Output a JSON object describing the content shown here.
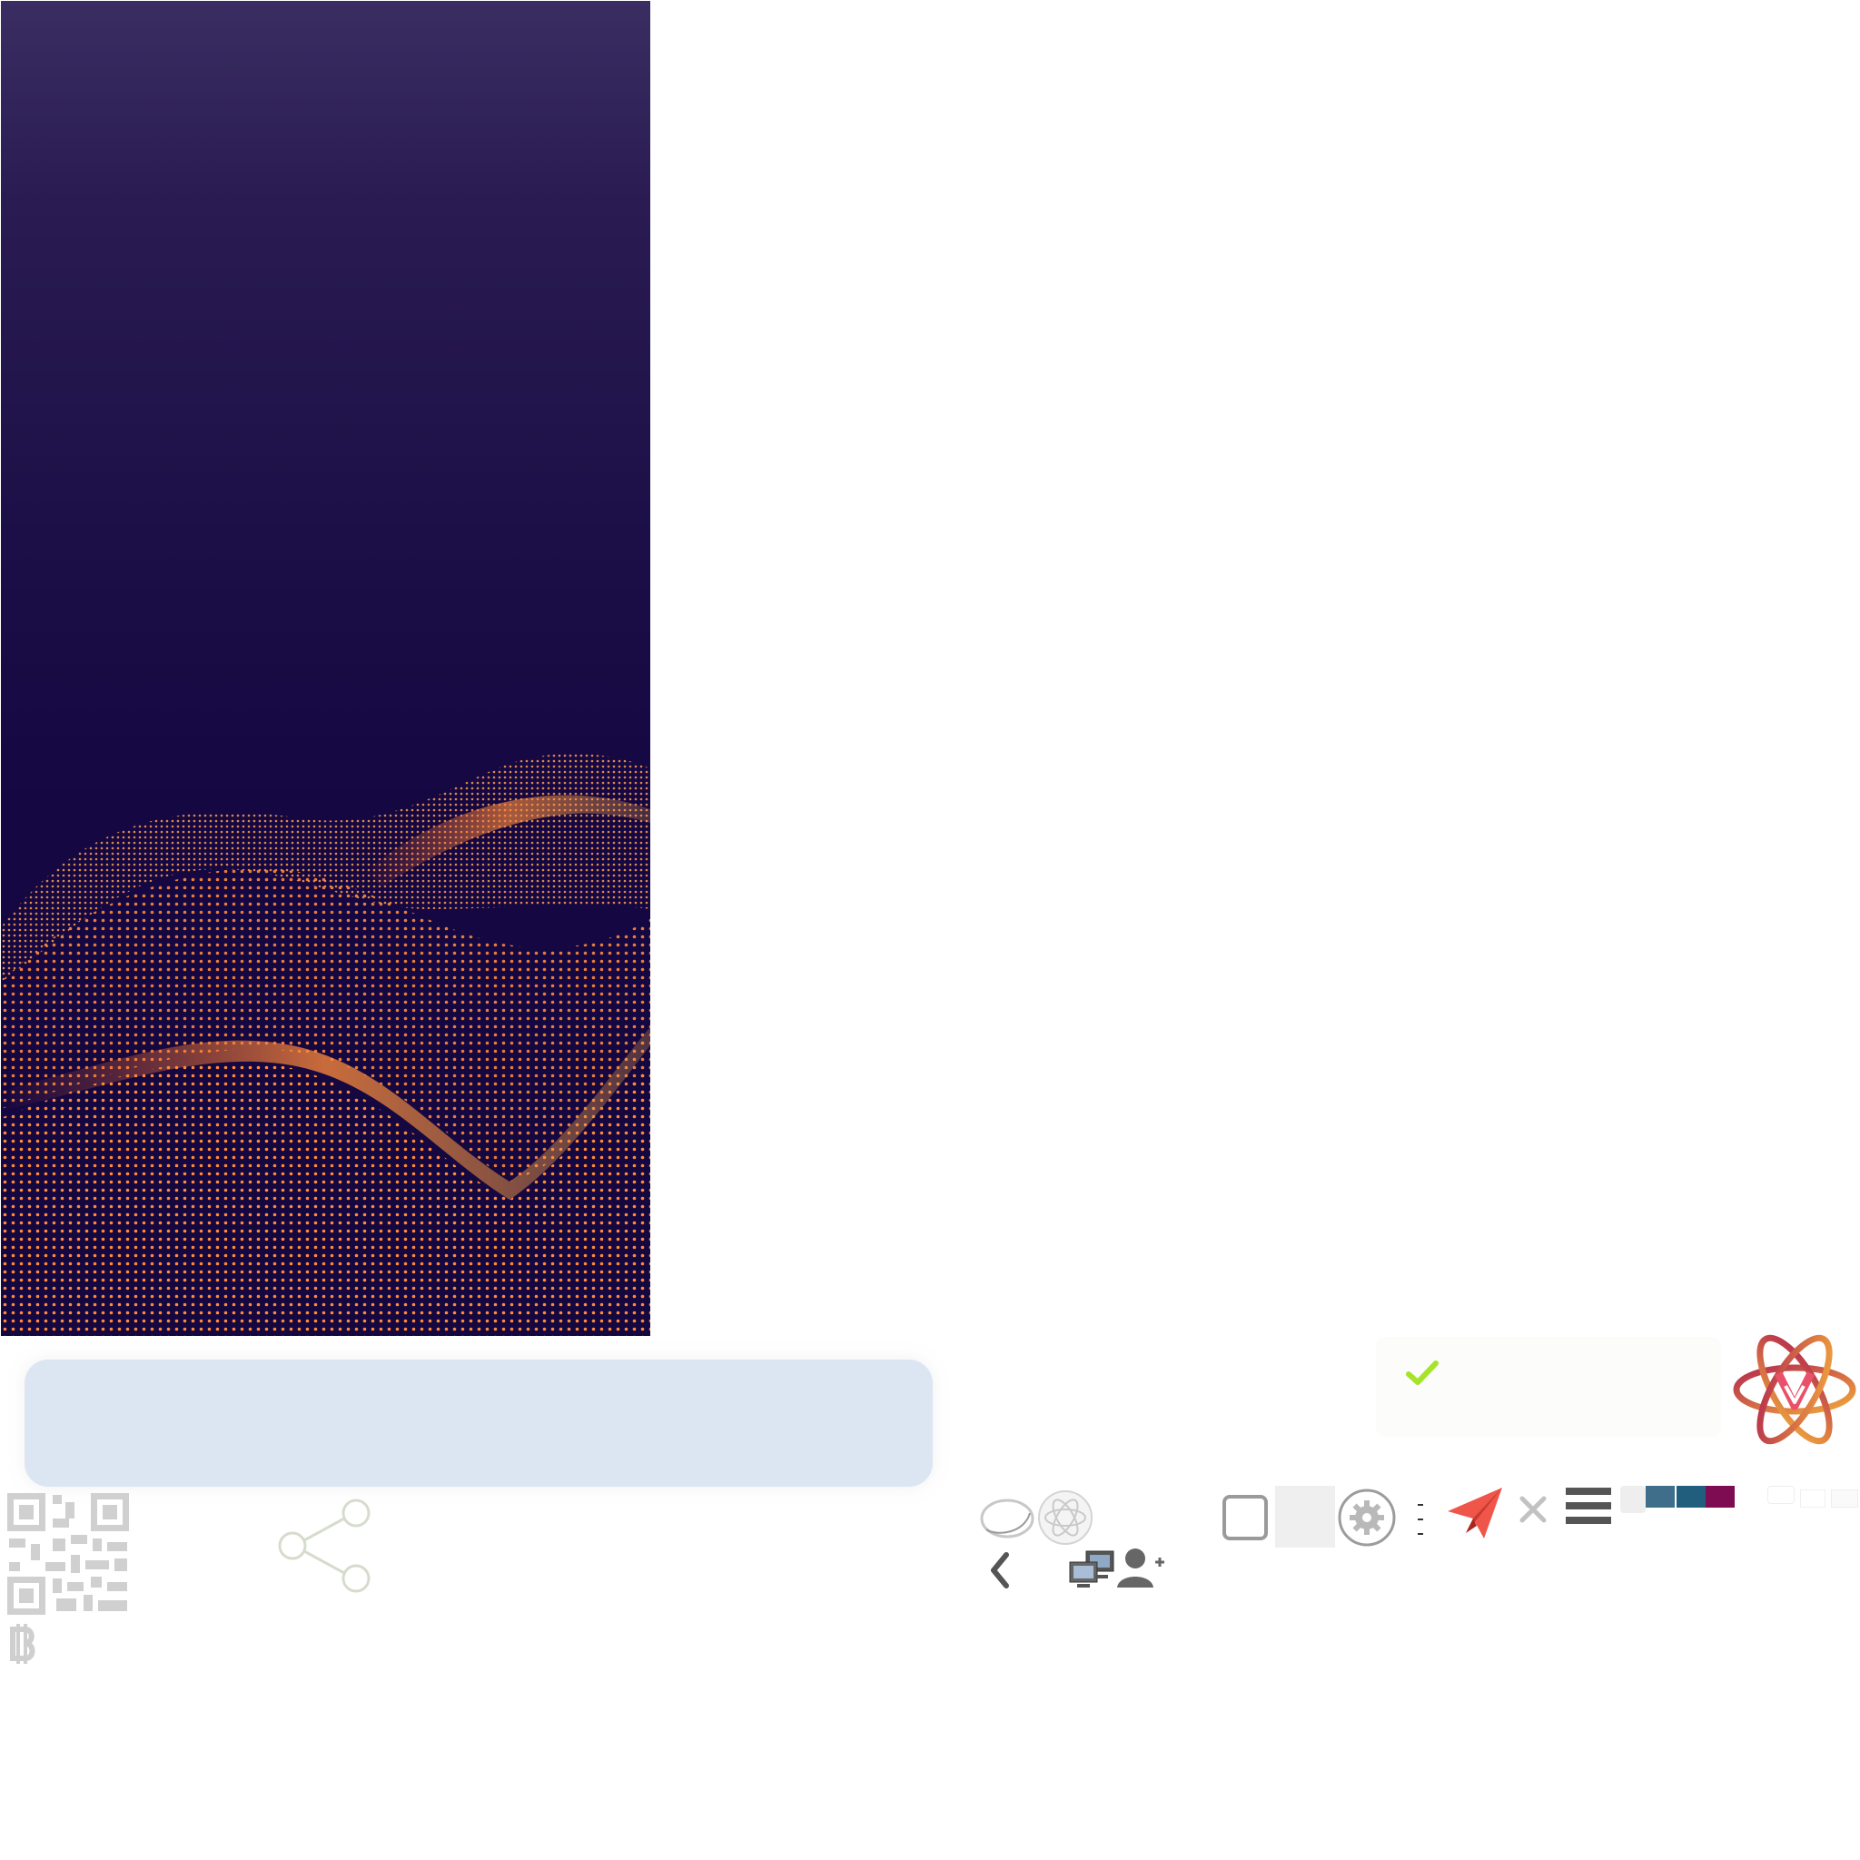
{
  "screen": {
    "title": "",
    "sprite_sheet": true
  },
  "splash": {
    "background_colors": [
      "#3a2d62",
      "#1c0f47",
      "#15073f"
    ],
    "wave_color": "#ff8a3a"
  },
  "bubble": {
    "color": "#dce6f3",
    "text": ""
  },
  "icons": {
    "check": "check-icon",
    "logo": "atom-v-logo",
    "qr": "qr-code-icon",
    "bitcoin": "bitcoin-icon",
    "share": "share-icon",
    "back": "chevron-left-icon",
    "network": "network-computers-icon",
    "add_user": "add-user-icon",
    "send": "paper-plane-icon",
    "close": "close-icon",
    "menu": "hamburger-menu-icon",
    "settings": "gear-icon",
    "atom": "atom-icon",
    "checkbox": "checkbox-icon"
  },
  "colors": {
    "check": "#a6e32b",
    "send": "#f0554a",
    "logo_start": "#b32a4f",
    "logo_end": "#f2a83c",
    "menu": "#555555"
  },
  "swatches": [
    {
      "name": "light-grey",
      "color": "#eeeeee"
    },
    {
      "name": "slate-blue",
      "color": "#3e6e8a"
    },
    {
      "name": "teal-blue",
      "color": "#215e7e"
    },
    {
      "name": "plum",
      "color": "#7d0c52"
    }
  ]
}
